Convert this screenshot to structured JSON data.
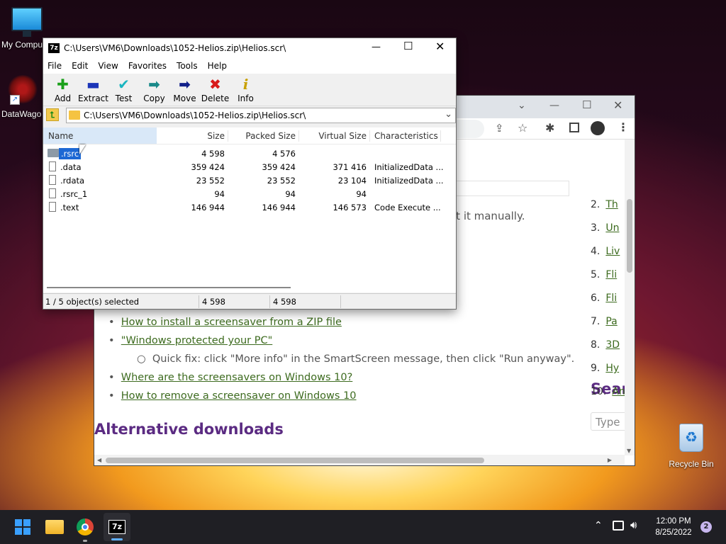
{
  "desktop": {
    "icons": [
      {
        "label": "My Compu"
      },
      {
        "label": "DataWago"
      },
      {
        "label": "Recycle Bin"
      }
    ]
  },
  "browser": {
    "sidebar": [
      {
        "num": "2.",
        "text": "Th"
      },
      {
        "num": "3.",
        "text": "Un"
      },
      {
        "num": "4.",
        "text": "Liv"
      },
      {
        "num": "5.",
        "text": "Fli"
      },
      {
        "num": "6.",
        "text": "Fli"
      },
      {
        "num": "7.",
        "text": "Pa"
      },
      {
        "num": "8.",
        "text": "3D"
      },
      {
        "num": "9.",
        "text": "Hy"
      },
      {
        "num": "10.",
        "text": "An"
      }
    ],
    "partial_text": "rt it manually.",
    "links": {
      "install_zip": "How to install a screensaver from a ZIP file",
      "windows_protected": "\"Windows protected your PC\"",
      "quick_fix": "Quick fix: click \"More info\" in the SmartScreen message, then click \"Run anyway\".",
      "where": "Where are the screensavers on Windows 10?",
      "remove": "How to remove a screensaver on Windows 10"
    },
    "headings": {
      "alt_downloads": "Alternative downloads",
      "search": "Sear"
    },
    "search_placeholder": "Type"
  },
  "zip": {
    "title": "C:\\Users\\VM6\\Downloads\\1052-Helios.zip\\Helios.scr\\",
    "title_icon": "7z",
    "menu": [
      "File",
      "Edit",
      "View",
      "Favorites",
      "Tools",
      "Help"
    ],
    "tools": [
      {
        "label": "Add",
        "icon": "plus-icon",
        "glyph": "✚",
        "color": "#1aa01a"
      },
      {
        "label": "Extract",
        "icon": "minus-icon",
        "glyph": "▬",
        "color": "#1c35b8"
      },
      {
        "label": "Test",
        "icon": "check-icon",
        "glyph": "✔",
        "color": "#19b5c0"
      },
      {
        "label": "Copy",
        "icon": "copy-arrow-icon",
        "glyph": "➡",
        "color": "#1a8a8a"
      },
      {
        "label": "Move",
        "icon": "move-arrow-icon",
        "glyph": "➡",
        "color": "#12208a"
      },
      {
        "label": "Delete",
        "icon": "delete-x-icon",
        "glyph": "✖",
        "color": "#d81a1a"
      },
      {
        "label": "Info",
        "icon": "info-icon",
        "glyph": "i",
        "color": "#c8a000"
      }
    ],
    "address": "C:\\Users\\VM6\\Downloads\\1052-Helios.zip\\Helios.scr\\",
    "columns": [
      "Name",
      "Size",
      "Packed Size",
      "Virtual Size",
      "Characteristics"
    ],
    "rows": [
      {
        "name": ".rsrc",
        "size": "4 598",
        "packed": "4 576",
        "virtual": "",
        "chars": "",
        "folder": true,
        "selected": true
      },
      {
        "name": ".data",
        "size": "359 424",
        "packed": "359 424",
        "virtual": "371 416",
        "chars": "InitializedData ...",
        "folder": false,
        "selected": false
      },
      {
        "name": ".rdata",
        "size": "23 552",
        "packed": "23 552",
        "virtual": "23 104",
        "chars": "InitializedData ...",
        "folder": false,
        "selected": false
      },
      {
        "name": ".rsrc_1",
        "size": "94",
        "packed": "94",
        "virtual": "94",
        "chars": "",
        "folder": false,
        "selected": false
      },
      {
        "name": ".text",
        "size": "146 944",
        "packed": "146 944",
        "virtual": "146 573",
        "chars": "Code Execute ...",
        "folder": false,
        "selected": false
      }
    ],
    "status": {
      "selection": "1 / 5 object(s) selected",
      "size": "4 598",
      "packed": "4 598"
    }
  },
  "taskbar": {
    "time": "12:00 PM",
    "date": "8/25/2022",
    "notifications": "2",
    "sevenzip_label": "7z"
  },
  "colors": {
    "accent": "#0078d4",
    "link": "#3d6b1f",
    "heading": "#5b2b82"
  }
}
